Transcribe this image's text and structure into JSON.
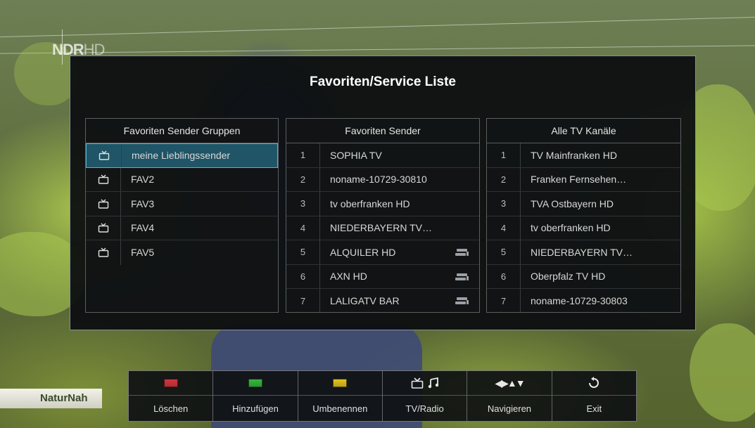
{
  "channel_logo": {
    "brand": "NDR",
    "suffix": "HD"
  },
  "program_badge": "NaturNah",
  "dialog": {
    "title": "Favoriten/Service Liste",
    "groups": {
      "header": "Favoriten Sender Gruppen",
      "items": [
        {
          "label": "meine Lieblingssender",
          "icon": "tv-icon",
          "selected": true
        },
        {
          "label": "FAV2",
          "icon": "tv-icon"
        },
        {
          "label": "FAV3",
          "icon": "tv-icon"
        },
        {
          "label": "FAV4",
          "icon": "tv-icon"
        },
        {
          "label": "FAV5",
          "icon": "tv-icon"
        }
      ]
    },
    "favorites": {
      "header": "Favoriten Sender",
      "items": [
        {
          "num": "1",
          "label": "SOPHIA TV"
        },
        {
          "num": "2",
          "label": "noname-10729-30810"
        },
        {
          "num": "3",
          "label": "tv oberfranken HD"
        },
        {
          "num": "4",
          "label": "NIEDERBAYERN TV…"
        },
        {
          "num": "5",
          "label": "ALQUILER HD",
          "icon": "satellite-icon"
        },
        {
          "num": "6",
          "label": "AXN HD",
          "icon": "satellite-icon"
        },
        {
          "num": "7",
          "label": "LALIGATV BAR",
          "icon": "satellite-icon"
        }
      ]
    },
    "all_channels": {
      "header": "Alle TV Kanäle",
      "items": [
        {
          "num": "1",
          "label": "TV Mainfranken HD"
        },
        {
          "num": "2",
          "label": "Franken Fernsehen…"
        },
        {
          "num": "3",
          "label": "TVA Ostbayern HD"
        },
        {
          "num": "4",
          "label": "tv oberfranken HD"
        },
        {
          "num": "5",
          "label": "NIEDERBAYERN TV…"
        },
        {
          "num": "6",
          "label": "Oberpfalz TV HD"
        },
        {
          "num": "7",
          "label": "noname-10729-30803"
        }
      ]
    }
  },
  "bottom_bar": [
    {
      "label": "Löschen",
      "icon": "red-key",
      "color": "#d3343f"
    },
    {
      "label": "Hinzufügen",
      "icon": "green-key",
      "color": "#35b83c"
    },
    {
      "label": "Umbenennen",
      "icon": "yellow-key",
      "color": "#e6c21e"
    },
    {
      "label": "TV/Radio",
      "icon": "tv-radio-icon"
    },
    {
      "label": "Navigieren",
      "icon": "arrows-icon"
    },
    {
      "label": "Exit",
      "icon": "back-icon"
    }
  ]
}
